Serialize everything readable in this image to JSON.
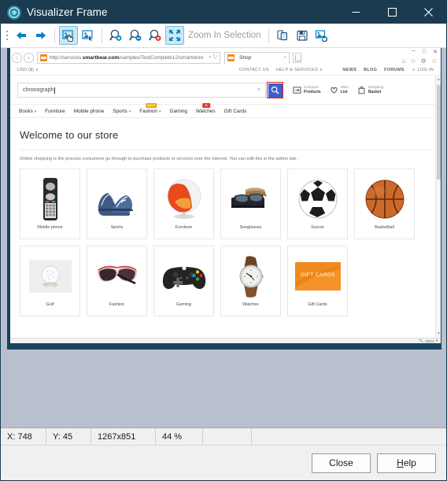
{
  "window": {
    "title": "Visualizer Frame",
    "icon": "visualizer-icon",
    "minimize": "minimize-icon",
    "maximize": "maximize-icon",
    "close": "close-icon"
  },
  "toolbar": {
    "back": "back-arrow-icon",
    "forward": "forward-arrow-icon",
    "pan_tool": "pan-image-icon",
    "select_tool": "select-image-icon",
    "zoom_in": "zoom-in-icon",
    "zoom_out": "zoom-out-icon",
    "zoom_reset": "zoom-reset-icon",
    "fit_screen": "fit-to-screen-icon",
    "zoom_in_selection_label": "Zoom In Selection",
    "copy": "copy-icon",
    "save": "save-floppy-icon",
    "refresh": "refresh-image-icon"
  },
  "status": {
    "x": "X: 748",
    "y": "Y: 45",
    "size": "1267x851",
    "zoom": "44 %",
    "extra1": "",
    "extra2": ""
  },
  "buttons": {
    "close": "Close",
    "help_prefix": "H",
    "help_rest": "elp"
  },
  "screenshot": {
    "browser": {
      "back_icon": "browser-back-icon",
      "forward_icon": "browser-forward-icon",
      "url": "http://services.",
      "url_bold": "smartbear.com",
      "url_rest": "/samples/TestComplete12/smartstore",
      "url_icons": "⌕ ↻",
      "tab_title": "Shop",
      "tab_close": "×",
      "new_tab": "new-tab-icon",
      "win_min": "─",
      "win_max": "□",
      "win_close": "✕",
      "tool_home": "⌂",
      "tool_fav": "☆",
      "tool_gear": "⚙",
      "tool_smiley": "☺",
      "zoom_level": "100%"
    },
    "page": {
      "currency": "USD ($)",
      "currency_caret": "∨",
      "topnav": [
        "CONTACT US",
        "HELP & SERVICES",
        "NEWS",
        "BLOG",
        "FORUMS"
      ],
      "help_caret": "∨",
      "login": "LOG IN",
      "login_icon": "user-icon",
      "search_value": "chronograph",
      "search_clear": "×",
      "search_button_icon": "search-icon",
      "utils": [
        {
          "icon": "compare-icon",
          "line1": "Compare",
          "line2": "Products"
        },
        {
          "icon": "heart-icon",
          "line1": "Wish",
          "line2": "List"
        },
        {
          "icon": "basket-icon",
          "line1": "Shopping",
          "line2": "Basket"
        }
      ],
      "mainnav": [
        {
          "label": "Books",
          "caret": true,
          "badge": null
        },
        {
          "label": "Furniture",
          "caret": false,
          "badge": null
        },
        {
          "label": "Mobile phone",
          "caret": false,
          "badge": null
        },
        {
          "label": "Sports",
          "caret": true,
          "badge": null
        },
        {
          "label": "Fashion",
          "caret": true,
          "badge": "SALE",
          "badge_kind": "sale"
        },
        {
          "label": "Gaming",
          "caret": false,
          "badge": null
        },
        {
          "label": "Watches",
          "caret": false,
          "badge": "%",
          "badge_kind": "pct"
        },
        {
          "label": "Gift Cards",
          "caret": false,
          "badge": null
        }
      ],
      "heading": "Welcome to our store",
      "intro": "Online shopping is the process consumers go through to purchase products or services over the Internet. You can edit this in the admin site.",
      "categories": [
        {
          "label": "Mobile phone",
          "art": "mobile-phone-image"
        },
        {
          "label": "Sports",
          "art": "sports-shoes-image"
        },
        {
          "label": "Furniture",
          "art": "ball-chair-image"
        },
        {
          "label": "Sunglasses",
          "art": "sunglasses-image"
        },
        {
          "label": "Soccer",
          "art": "soccer-ball-image"
        },
        {
          "label": "Basketball",
          "art": "basketball-image"
        },
        {
          "label": "Golf",
          "art": "golf-ball-image"
        },
        {
          "label": "Fashion",
          "art": "fashion-sunglasses-image"
        },
        {
          "label": "Gaming",
          "art": "gamepad-image"
        },
        {
          "label": "Watches",
          "art": "wristwatch-image"
        },
        {
          "label": "Gift Cards",
          "art": "gift-card-image"
        }
      ],
      "gift_card_text": "GIFT CARDS"
    }
  },
  "colors": {
    "title_bar": "#1b3b51",
    "accent": "#0a7fc1",
    "viewport_bg": "#b9c0cd",
    "highlight_red": "#e01b1b",
    "search_blue": "#3c5fcd",
    "sale_orange": "#f0a500",
    "pct_red": "#e13a2b"
  }
}
